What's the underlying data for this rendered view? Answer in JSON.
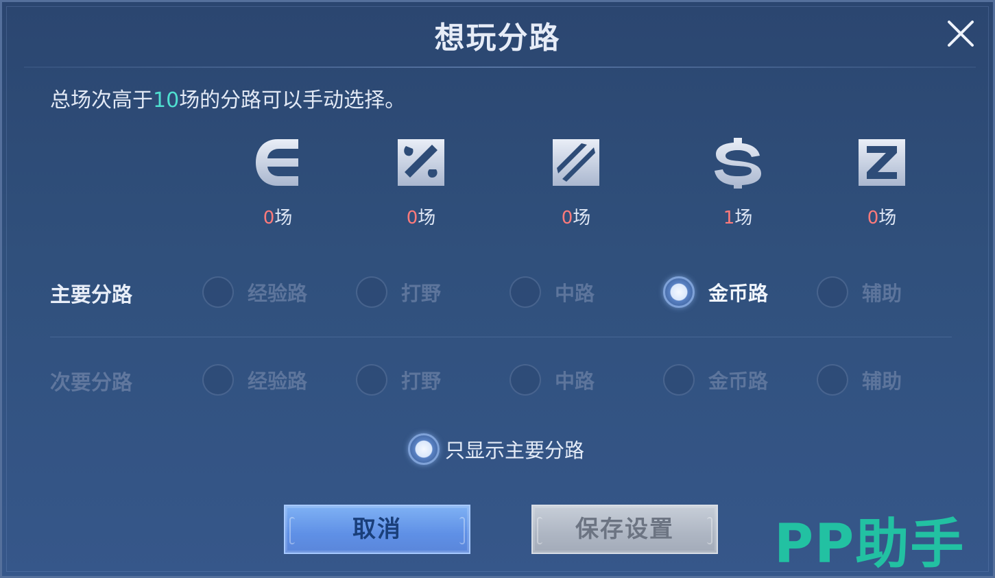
{
  "dialog": {
    "title": "想玩分路",
    "notice_before": "总场次高于",
    "notice_highlight": "10",
    "notice_after": "场的分路可以手动选择。"
  },
  "lanes": [
    {
      "icon": "clash-lane-icon",
      "count": "0",
      "unit": "场"
    },
    {
      "icon": "jungle-icon",
      "count": "0",
      "unit": "场"
    },
    {
      "icon": "mid-lane-icon",
      "count": "0",
      "unit": "场"
    },
    {
      "icon": "farm-lane-icon",
      "count": "1",
      "unit": "场"
    },
    {
      "icon": "support-icon",
      "count": "0",
      "unit": "场"
    }
  ],
  "primary": {
    "label": "主要分路",
    "options": [
      "经验路",
      "打野",
      "中路",
      "金币路",
      "辅助"
    ],
    "selected": "金币路"
  },
  "secondary": {
    "label": "次要分路",
    "options": [
      "经验路",
      "打野",
      "中路",
      "金币路",
      "辅助"
    ],
    "selected": ""
  },
  "only_main": {
    "label": "只显示主要分路",
    "checked": true
  },
  "buttons": {
    "cancel": "取消",
    "save": "保存设置"
  },
  "watermark": "PP助手",
  "colors": {
    "highlight": "#4fe0d0",
    "count_number": "#ff7a7a",
    "watermark": "#22c1a2"
  }
}
